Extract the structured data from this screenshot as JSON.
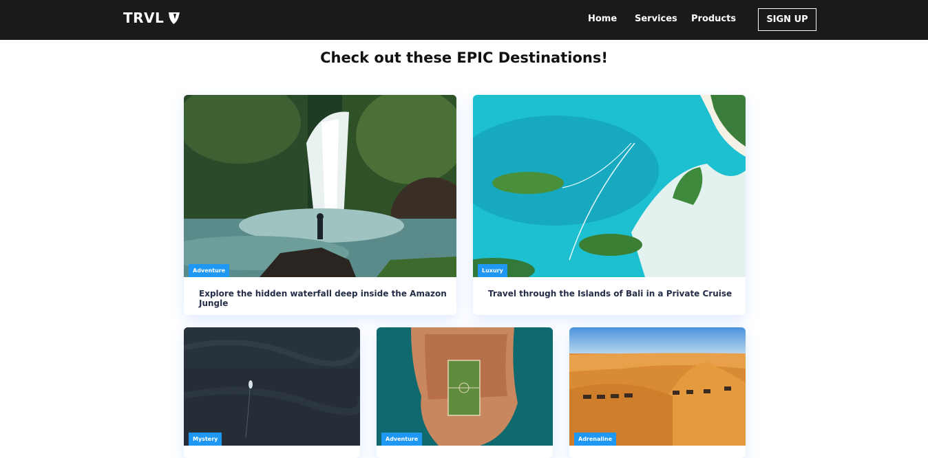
{
  "nav": {
    "logo": "TRVL",
    "links": [
      "Home",
      "Services",
      "Products"
    ],
    "signup": "SIGN UP"
  },
  "title": "Check out these EPIC Destinations!",
  "cards": [
    {
      "badge": "Adventure",
      "text": "Explore the hidden waterfall deep inside the Amazon Jungle"
    },
    {
      "badge": "Luxury",
      "text": "Travel through the Islands of Bali in a Private Cruise"
    },
    {
      "badge": "Mystery",
      "text": ""
    },
    {
      "badge": "Adventure",
      "text": ""
    },
    {
      "badge": "Adrenaline",
      "text": ""
    }
  ],
  "colors": {
    "navbar": "#1b1a1a",
    "badge": "#1f98f4",
    "card_text": "#252e48"
  }
}
